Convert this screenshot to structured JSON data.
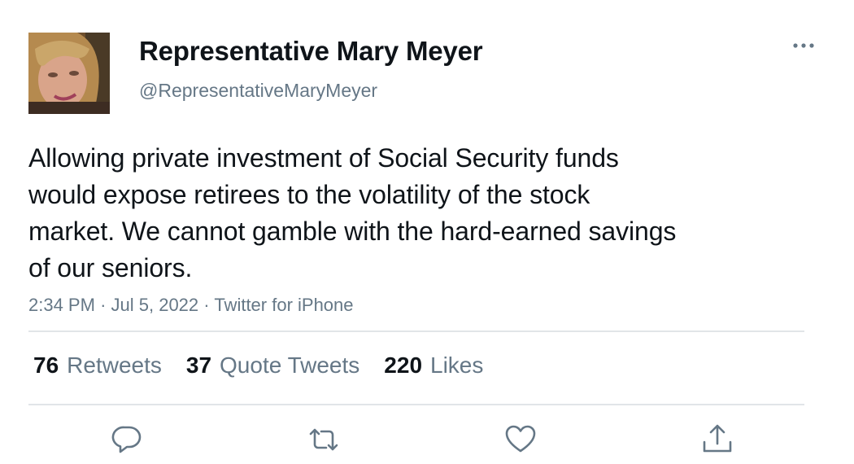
{
  "author": {
    "display_name": "Representative Mary Meyer",
    "handle": "@RepresentativeMaryMeyer"
  },
  "tweet": {
    "lines": [
      "Allowing private investment of Social Security funds",
      "would expose retirees to the volatility of the stock",
      "market. We cannot gamble with the hard-earned savings",
      "of our seniors."
    ],
    "time": "2:34 PM",
    "date": "Jul 5, 2022",
    "source": "Twitter for iPhone",
    "separator": "·"
  },
  "stats": {
    "retweets": {
      "count": "76",
      "label": "Retweets"
    },
    "quotes": {
      "count": "37",
      "label": "Quote Tweets"
    },
    "likes": {
      "count": "220",
      "label": "Likes"
    }
  },
  "actions": {
    "reply_icon": "reply-icon",
    "retweet_icon": "retweet-icon",
    "like_icon": "heart-icon",
    "share_icon": "share-icon"
  },
  "colors": {
    "text": "#0f1419",
    "secondary": "#657786",
    "divider": "#e1e5e8"
  }
}
